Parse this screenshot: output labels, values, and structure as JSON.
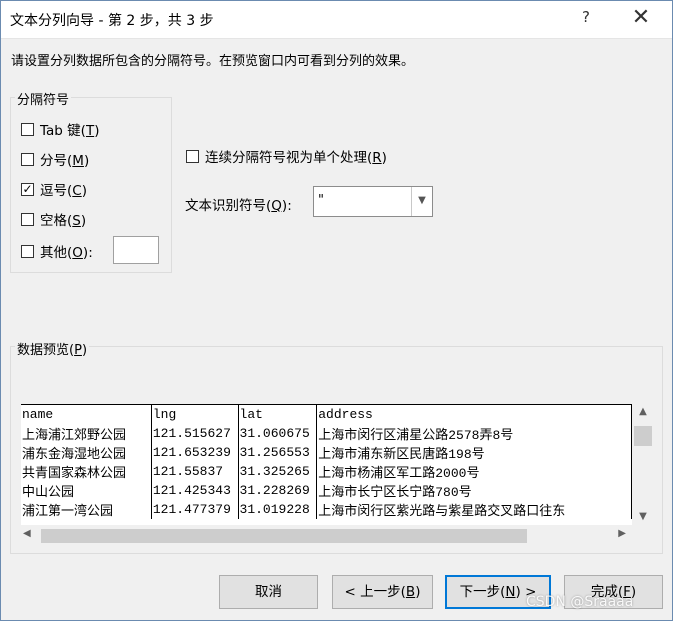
{
  "window": {
    "title": "文本分列向导 - 第 2 步，共 3 步",
    "help_label": "?",
    "close_label": "✕"
  },
  "instruction": "请设置分列数据所包含的分隔符号。在预览窗口内可看到分列的效果。",
  "delimiters": {
    "legend": "分隔符号",
    "items": [
      {
        "label": "Tab 键",
        "hotkey": "T",
        "checked": false
      },
      {
        "label": "分号",
        "hotkey": "M",
        "checked": false
      },
      {
        "label": "逗号",
        "hotkey": "C",
        "checked": true
      },
      {
        "label": "空格",
        "hotkey": "S",
        "checked": false
      },
      {
        "label": "其他",
        "hotkey": "O",
        "suffix": ":",
        "checked": false
      }
    ],
    "other_value": ""
  },
  "consecutive": {
    "label": "连续分隔符号视为单个处理",
    "hotkey": "R",
    "checked": false
  },
  "text_qualifier": {
    "label": "文本识别符号",
    "hotkey": "Q",
    "suffix": ":",
    "value": "\""
  },
  "preview": {
    "legend": "数据预览",
    "hotkey": "P",
    "rows": [
      [
        "name",
        "lng",
        "lat",
        "address"
      ],
      [
        "上海浦江郊野公园",
        "121.515627",
        "31.060675",
        "上海市闵行区浦星公路2578弄8号"
      ],
      [
        "浦东金海湿地公园",
        "121.653239",
        "31.256553",
        "上海市浦东新区民唐路198号"
      ],
      [
        "共青国家森林公园",
        "121.55837",
        "31.325265",
        "上海市杨浦区军工路2000号"
      ],
      [
        "中山公园",
        "121.425343",
        "31.228269",
        "上海市长宁区长宁路780号"
      ],
      [
        "浦江第一湾公园",
        "121.477379",
        "31.019228",
        "上海市闵行区紫光路与紫星路交叉路口往东"
      ]
    ]
  },
  "buttons": {
    "cancel": "取消",
    "back": "< 上一步",
    "back_hotkey": "B",
    "next": "下一步",
    "next_hotkey": "N",
    "next_suffix": " >",
    "finish": "完成",
    "finish_hotkey": "F"
  },
  "watermark": "CSDN @Sraaaa"
}
